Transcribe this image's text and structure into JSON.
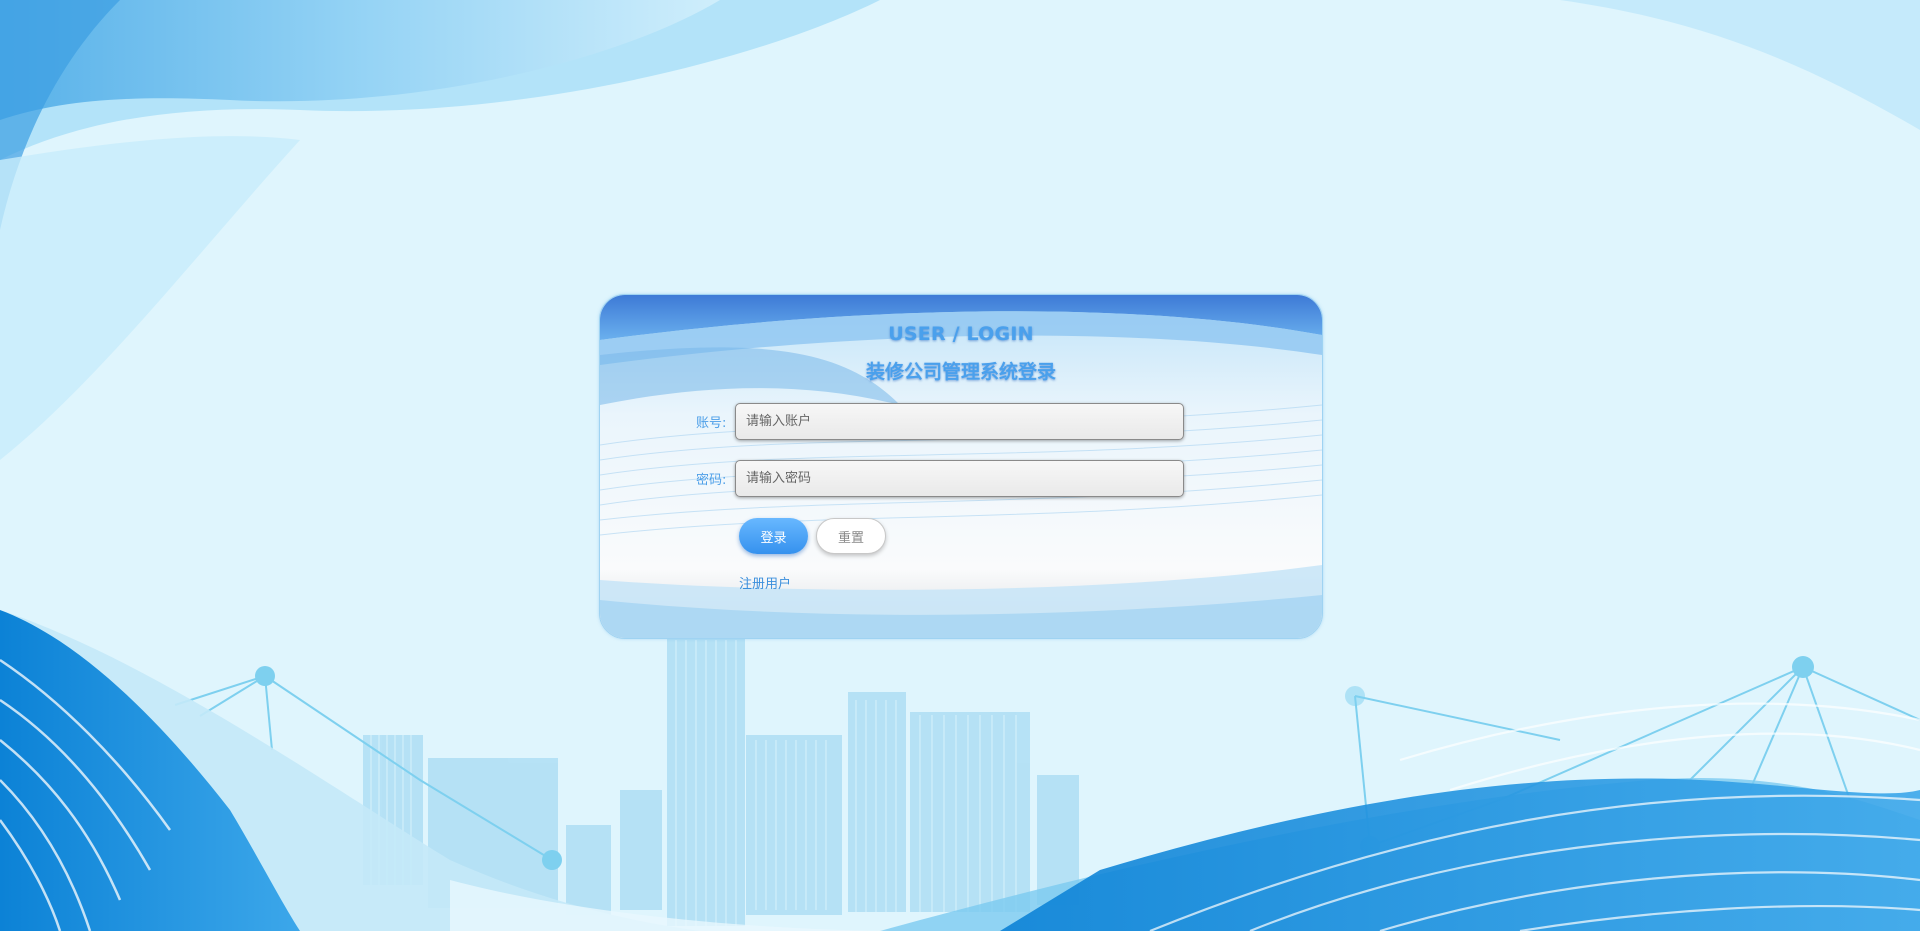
{
  "login": {
    "title_en": "USER / LOGIN",
    "title_cn": "装修公司管理系统登录",
    "account_label": "账号:",
    "account_placeholder": "请输入账户",
    "account_value": "",
    "password_label": "密码:",
    "password_placeholder": "请输入密码",
    "password_value": "",
    "login_button": "登录",
    "reset_button": "重置",
    "register_link": "注册用户"
  },
  "colors": {
    "background": "#dff5fd",
    "accent": "#4aa0ec",
    "login_button": "#3591ee",
    "wave_dark": "#1a8ad8"
  }
}
